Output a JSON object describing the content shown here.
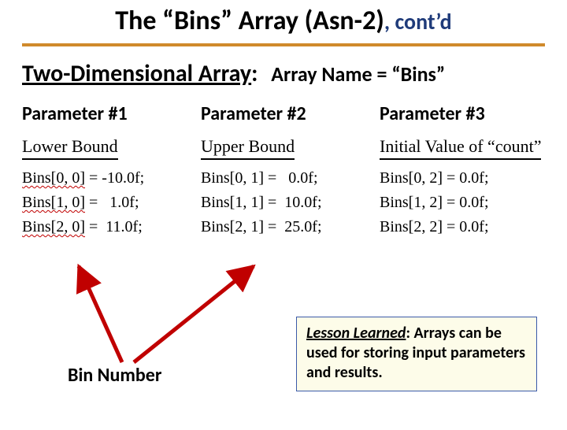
{
  "title": {
    "main": "The “Bins” Array (Asn-2)",
    "cont": ", cont’d"
  },
  "subhead": {
    "lead": "Two-Dimensional Array",
    "colon": ":",
    "array_name": "Array Name = “Bins”"
  },
  "columns": [
    {
      "param_label": "Parameter #1",
      "col_title": "Lower Bound",
      "lines": [
        {
          "idx": "Bins[0, 0]",
          "rest": " = -10.0f;"
        },
        {
          "idx": "Bins[1, 0]",
          "rest": " =   1.0f;"
        },
        {
          "idx": "Bins[2, 0]",
          "rest": " =  11.0f;"
        }
      ]
    },
    {
      "param_label": "Parameter #2",
      "col_title": "Upper Bound",
      "lines": [
        {
          "idx": "Bins[0, 1]",
          "rest": " =   0.0f;"
        },
        {
          "idx": "Bins[1, 1]",
          "rest": " =  10.0f;"
        },
        {
          "idx": "Bins[2, 1]",
          "rest": " =  25.0f;"
        }
      ]
    },
    {
      "param_label": "Parameter #3",
      "col_title": "Initial Value of “count”",
      "lines": [
        {
          "idx": "Bins[0, 2]",
          "rest": " = 0.0f;"
        },
        {
          "idx": "Bins[1, 2]",
          "rest": " = 0.0f;"
        },
        {
          "idx": "Bins[2, 2]",
          "rest": " = 0.0f;"
        }
      ]
    }
  ],
  "bin_label": "Bin Number",
  "lesson": {
    "label": "Lesson Learned",
    "text": ": Arrays can be used for storing input parameters and results."
  },
  "colors": {
    "accent_rule": "#d08a2c",
    "title_accent": "#1f3b7a",
    "arrow": "#c00000",
    "box_border": "#3a5aa9",
    "box_fill": "#fdfce9"
  }
}
